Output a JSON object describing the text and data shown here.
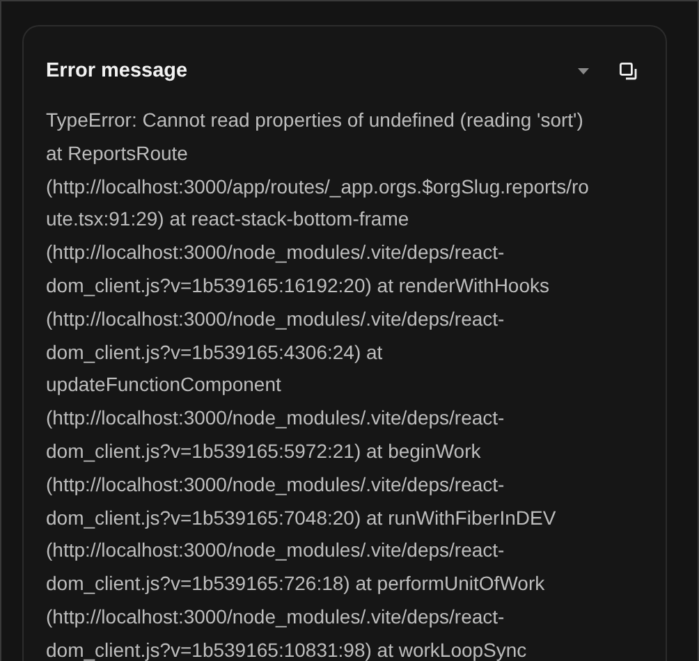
{
  "card": {
    "title": "Error message",
    "lines": [
      "TypeError: Cannot read properties of undefined (reading 'sort')",
      "at ReportsRoute",
      "(http://localhost:3000/app/routes/_app.orgs.$orgSlug.reports/ro",
      "ute.tsx:91:29) at react-stack-bottom-frame",
      "(http://localhost:3000/node_modules/.vite/deps/react-",
      "dom_client.js?v=1b539165:16192:20) at renderWithHooks",
      "(http://localhost:3000/node_modules/.vite/deps/react-",
      "dom_client.js?v=1b539165:4306:24) at",
      "updateFunctionComponent",
      "(http://localhost:3000/node_modules/.vite/deps/react-",
      "dom_client.js?v=1b539165:5972:21) at beginWork",
      "(http://localhost:3000/node_modules/.vite/deps/react-",
      "dom_client.js?v=1b539165:7048:20) at runWithFiberInDEV",
      "(http://localhost:3000/node_modules/.vite/deps/react-",
      "dom_client.js?v=1b539165:726:18) at performUnitOfWork",
      "(http://localhost:3000/node_modules/.vite/deps/react-",
      "dom_client.js?v=1b539165:10831:98) at workLoopSync"
    ]
  }
}
